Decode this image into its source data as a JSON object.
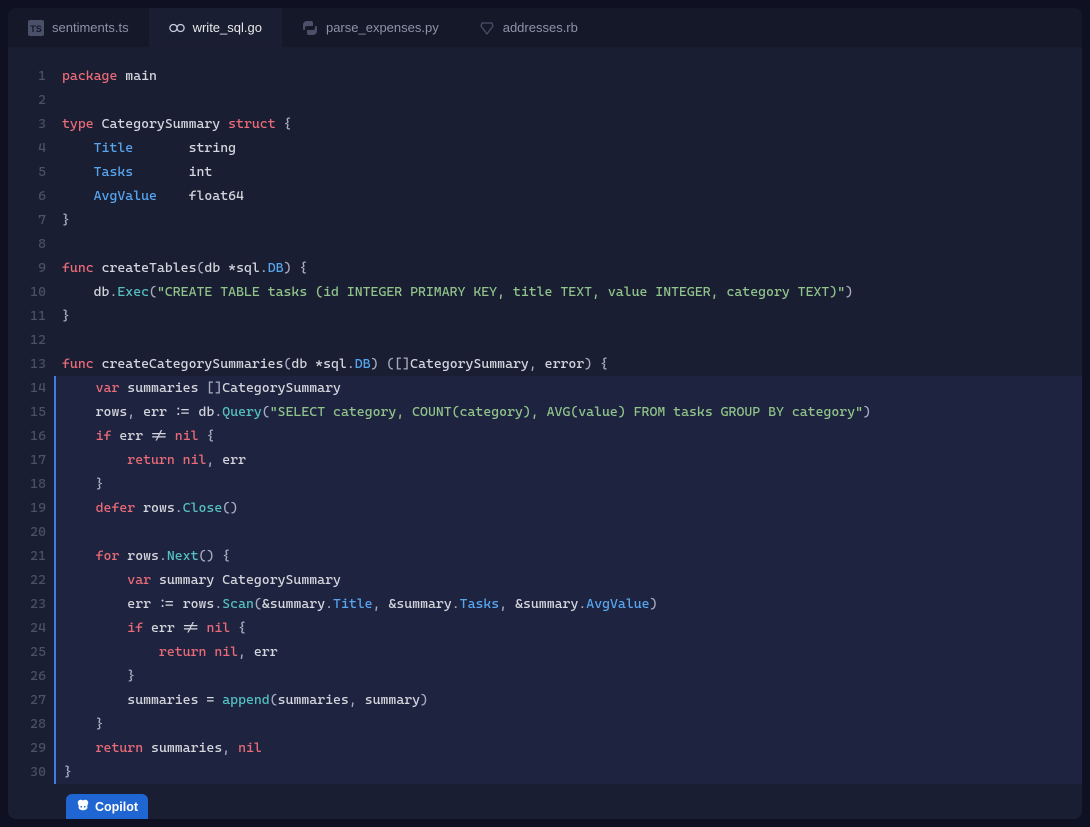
{
  "tabs": [
    {
      "label": "sentiments.ts",
      "icon": "ts-icon",
      "active": false
    },
    {
      "label": "write_sql.go",
      "icon": "go-icon",
      "active": true
    },
    {
      "label": "parse_expenses.py",
      "icon": "python-icon",
      "active": false
    },
    {
      "label": "addresses.rb",
      "icon": "ruby-icon",
      "active": false
    }
  ],
  "copilot": {
    "label": "Copilot"
  },
  "code": {
    "lines": [
      {
        "n": 1,
        "t": [
          [
            "kw",
            "package"
          ],
          [
            "sp",
            " "
          ],
          [
            "pkgname",
            "main"
          ]
        ]
      },
      {
        "n": 2,
        "t": []
      },
      {
        "n": 3,
        "t": [
          [
            "kw",
            "type"
          ],
          [
            "sp",
            " "
          ],
          [
            "type",
            "CategorySummary"
          ],
          [
            "sp",
            " "
          ],
          [
            "kw",
            "struct"
          ],
          [
            "sp",
            " "
          ],
          [
            "punct",
            "{"
          ]
        ]
      },
      {
        "n": 4,
        "t": [
          [
            "sp",
            "    "
          ],
          [
            "field",
            "Title"
          ],
          [
            "sp",
            "       "
          ],
          [
            "ident",
            "string"
          ]
        ]
      },
      {
        "n": 5,
        "t": [
          [
            "sp",
            "    "
          ],
          [
            "field",
            "Tasks"
          ],
          [
            "sp",
            "       "
          ],
          [
            "ident",
            "int"
          ]
        ]
      },
      {
        "n": 6,
        "t": [
          [
            "sp",
            "    "
          ],
          [
            "field",
            "AvgValue"
          ],
          [
            "sp",
            "    "
          ],
          [
            "ident",
            "float64"
          ]
        ]
      },
      {
        "n": 7,
        "t": [
          [
            "punct",
            "}"
          ]
        ]
      },
      {
        "n": 8,
        "t": []
      },
      {
        "n": 9,
        "t": [
          [
            "kw",
            "func"
          ],
          [
            "sp",
            " "
          ],
          [
            "fnname",
            "createTables"
          ],
          [
            "punct",
            "("
          ],
          [
            "ident",
            "db"
          ],
          [
            "sp",
            " "
          ],
          [
            "op",
            "*"
          ],
          [
            "ident",
            "sql"
          ],
          [
            "punct",
            "."
          ],
          [
            "field",
            "DB"
          ],
          [
            "punct",
            ")"
          ],
          [
            "sp",
            " "
          ],
          [
            "punct",
            "{"
          ]
        ]
      },
      {
        "n": 10,
        "t": [
          [
            "sp",
            "    "
          ],
          [
            "ident",
            "db"
          ],
          [
            "punct",
            "."
          ],
          [
            "method",
            "Exec"
          ],
          [
            "punct",
            "("
          ],
          [
            "string",
            "\"CREATE TABLE tasks (id INTEGER PRIMARY KEY, title TEXT, value INTEGER, category TEXT)\""
          ],
          [
            "punct",
            ")"
          ]
        ]
      },
      {
        "n": 11,
        "t": [
          [
            "punct",
            "}"
          ]
        ]
      },
      {
        "n": 12,
        "t": []
      },
      {
        "n": 13,
        "t": [
          [
            "kw",
            "func"
          ],
          [
            "sp",
            " "
          ],
          [
            "fnname",
            "createCategorySummaries"
          ],
          [
            "punct",
            "("
          ],
          [
            "ident",
            "db"
          ],
          [
            "sp",
            " "
          ],
          [
            "op",
            "*"
          ],
          [
            "ident",
            "sql"
          ],
          [
            "punct",
            "."
          ],
          [
            "field",
            "DB"
          ],
          [
            "punct",
            ")"
          ],
          [
            "sp",
            " "
          ],
          [
            "punct",
            "(["
          ],
          [
            "punct",
            "]"
          ],
          [
            "type",
            "CategorySummary"
          ],
          [
            "punct",
            ","
          ],
          [
            "sp",
            " "
          ],
          [
            "ident",
            "error"
          ],
          [
            "punct",
            ")"
          ],
          [
            "sp",
            " "
          ],
          [
            "punct",
            "{"
          ]
        ]
      },
      {
        "n": 14,
        "sug": true,
        "t": [
          [
            "sp",
            "    "
          ],
          [
            "kw",
            "var"
          ],
          [
            "sp",
            " "
          ],
          [
            "ident",
            "summaries"
          ],
          [
            "sp",
            " "
          ],
          [
            "punct",
            "[]"
          ],
          [
            "type",
            "CategorySummary"
          ]
        ]
      },
      {
        "n": 15,
        "sug": true,
        "t": [
          [
            "sp",
            "    "
          ],
          [
            "ident",
            "rows"
          ],
          [
            "punct",
            ","
          ],
          [
            "sp",
            " "
          ],
          [
            "ident",
            "err"
          ],
          [
            "sp",
            " "
          ],
          [
            "op",
            ":="
          ],
          [
            "sp",
            " "
          ],
          [
            "ident",
            "db"
          ],
          [
            "punct",
            "."
          ],
          [
            "method",
            "Query"
          ],
          [
            "punct",
            "("
          ],
          [
            "string",
            "\"SELECT category, COUNT(category), AVG(value) FROM tasks GROUP BY category\""
          ],
          [
            "punct",
            ")"
          ]
        ]
      },
      {
        "n": 16,
        "sug": true,
        "t": [
          [
            "sp",
            "    "
          ],
          [
            "kw",
            "if"
          ],
          [
            "sp",
            " "
          ],
          [
            "ident",
            "err"
          ],
          [
            "sp",
            " "
          ],
          [
            "op",
            "!="
          ],
          [
            "sp",
            " "
          ],
          [
            "nil",
            "nil"
          ],
          [
            "sp",
            " "
          ],
          [
            "punct",
            "{"
          ]
        ]
      },
      {
        "n": 17,
        "sug": true,
        "t": [
          [
            "sp",
            "        "
          ],
          [
            "kw",
            "return"
          ],
          [
            "sp",
            " "
          ],
          [
            "nil",
            "nil"
          ],
          [
            "punct",
            ","
          ],
          [
            "sp",
            " "
          ],
          [
            "ident",
            "err"
          ]
        ]
      },
      {
        "n": 18,
        "sug": true,
        "t": [
          [
            "sp",
            "    "
          ],
          [
            "punct",
            "}"
          ]
        ]
      },
      {
        "n": 19,
        "sug": true,
        "t": [
          [
            "sp",
            "    "
          ],
          [
            "kw",
            "defer"
          ],
          [
            "sp",
            " "
          ],
          [
            "ident",
            "rows"
          ],
          [
            "punct",
            "."
          ],
          [
            "method",
            "Close"
          ],
          [
            "punct",
            "()"
          ]
        ]
      },
      {
        "n": 20,
        "sug": true,
        "t": []
      },
      {
        "n": 21,
        "sug": true,
        "t": [
          [
            "sp",
            "    "
          ],
          [
            "kw",
            "for"
          ],
          [
            "sp",
            " "
          ],
          [
            "ident",
            "rows"
          ],
          [
            "punct",
            "."
          ],
          [
            "method",
            "Next"
          ],
          [
            "punct",
            "()"
          ],
          [
            "sp",
            " "
          ],
          [
            "punct",
            "{"
          ]
        ]
      },
      {
        "n": 22,
        "sug": true,
        "t": [
          [
            "sp",
            "        "
          ],
          [
            "kw",
            "var"
          ],
          [
            "sp",
            " "
          ],
          [
            "ident",
            "summary"
          ],
          [
            "sp",
            " "
          ],
          [
            "type",
            "CategorySummary"
          ]
        ]
      },
      {
        "n": 23,
        "sug": true,
        "t": [
          [
            "sp",
            "        "
          ],
          [
            "ident",
            "err"
          ],
          [
            "sp",
            " "
          ],
          [
            "op",
            ":="
          ],
          [
            "sp",
            " "
          ],
          [
            "ident",
            "rows"
          ],
          [
            "punct",
            "."
          ],
          [
            "method",
            "Scan"
          ],
          [
            "punct",
            "("
          ],
          [
            "op",
            "&"
          ],
          [
            "ident",
            "summary"
          ],
          [
            "punct",
            "."
          ],
          [
            "field",
            "Title"
          ],
          [
            "punct",
            ","
          ],
          [
            "sp",
            " "
          ],
          [
            "op",
            "&"
          ],
          [
            "ident",
            "summary"
          ],
          [
            "punct",
            "."
          ],
          [
            "field",
            "Tasks"
          ],
          [
            "punct",
            ","
          ],
          [
            "sp",
            " "
          ],
          [
            "op",
            "&"
          ],
          [
            "ident",
            "summary"
          ],
          [
            "punct",
            "."
          ],
          [
            "field",
            "AvgValue"
          ],
          [
            "punct",
            ")"
          ]
        ]
      },
      {
        "n": 24,
        "sug": true,
        "t": [
          [
            "sp",
            "        "
          ],
          [
            "kw",
            "if"
          ],
          [
            "sp",
            " "
          ],
          [
            "ident",
            "err"
          ],
          [
            "sp",
            " "
          ],
          [
            "op",
            "!="
          ],
          [
            "sp",
            " "
          ],
          [
            "nil",
            "nil"
          ],
          [
            "sp",
            " "
          ],
          [
            "punct",
            "{"
          ]
        ]
      },
      {
        "n": 25,
        "sug": true,
        "t": [
          [
            "sp",
            "            "
          ],
          [
            "kw",
            "return"
          ],
          [
            "sp",
            " "
          ],
          [
            "nil",
            "nil"
          ],
          [
            "punct",
            ","
          ],
          [
            "sp",
            " "
          ],
          [
            "ident",
            "err"
          ]
        ]
      },
      {
        "n": 26,
        "sug": true,
        "t": [
          [
            "sp",
            "        "
          ],
          [
            "punct",
            "}"
          ]
        ]
      },
      {
        "n": 27,
        "sug": true,
        "t": [
          [
            "sp",
            "        "
          ],
          [
            "ident",
            "summaries"
          ],
          [
            "sp",
            " "
          ],
          [
            "op",
            "="
          ],
          [
            "sp",
            " "
          ],
          [
            "builtin",
            "append"
          ],
          [
            "punct",
            "("
          ],
          [
            "ident",
            "summaries"
          ],
          [
            "punct",
            ","
          ],
          [
            "sp",
            " "
          ],
          [
            "ident",
            "summary"
          ],
          [
            "punct",
            ")"
          ]
        ]
      },
      {
        "n": 28,
        "sug": true,
        "t": [
          [
            "sp",
            "    "
          ],
          [
            "punct",
            "}"
          ]
        ]
      },
      {
        "n": 29,
        "sug": true,
        "t": [
          [
            "sp",
            "    "
          ],
          [
            "kw",
            "return"
          ],
          [
            "sp",
            " "
          ],
          [
            "ident",
            "summaries"
          ],
          [
            "punct",
            ","
          ],
          [
            "sp",
            " "
          ],
          [
            "nil",
            "nil"
          ]
        ]
      },
      {
        "n": 30,
        "sug": true,
        "t": [
          [
            "punct",
            "}"
          ]
        ]
      }
    ]
  }
}
